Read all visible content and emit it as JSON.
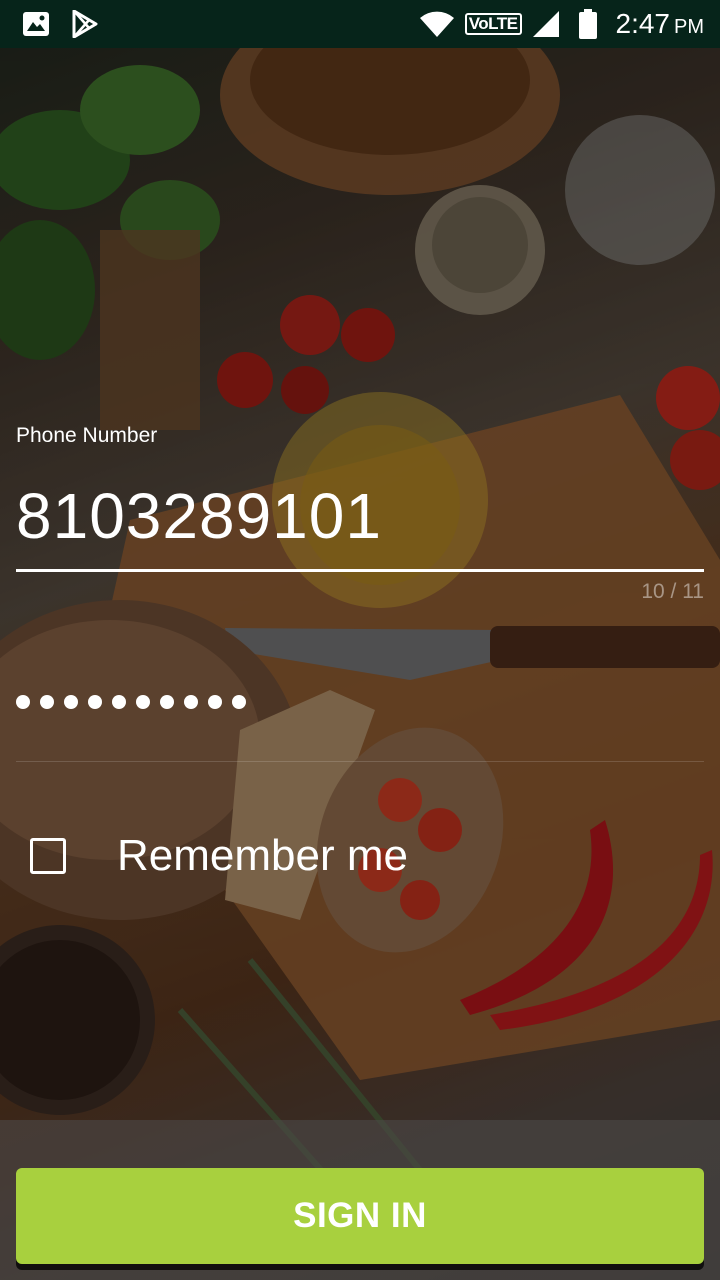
{
  "status_bar": {
    "left_icons": [
      "image-icon",
      "play-store-icon"
    ],
    "volte": "VoLTE",
    "time": "2:47",
    "ampm": "PM"
  },
  "form": {
    "phone_label": "Phone Number",
    "phone_value": "8103289101",
    "char_counter": "10 / 11",
    "password_mask_length": 10,
    "remember_label": "Remember me",
    "remember_checked": false
  },
  "signin": {
    "label": "SIGN IN"
  },
  "colors": {
    "status_bar_bg": "#06241a",
    "signin_button": "#a8d03e",
    "text": "#ffffff"
  }
}
